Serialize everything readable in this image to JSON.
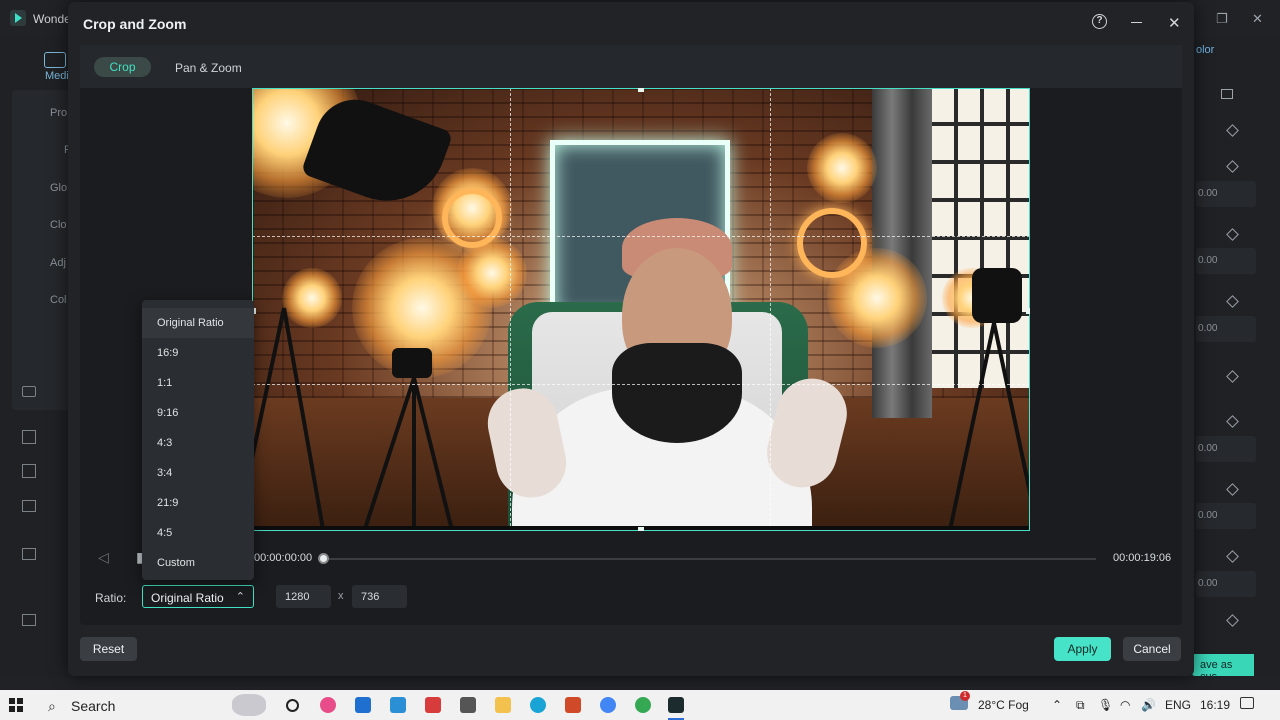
{
  "app": {
    "title": "Wonde",
    "left_items": [
      "Medi",
      "Pro",
      "F",
      "Glo",
      "Clo",
      "Adj",
      "Col"
    ],
    "right_tab": "olor",
    "right_values": [
      "0.00",
      "0.00",
      "0.00",
      "0.00",
      "0.00",
      "0.00",
      "0.00"
    ],
    "save_custom_label": "ave as cus..."
  },
  "dialog": {
    "title": "Crop and Zoom",
    "tabs": [
      {
        "label": "Crop",
        "active": true
      },
      {
        "label": "Pan & Zoom",
        "active": false
      }
    ]
  },
  "playback": {
    "current_time": "00:00:00:00",
    "total_time": "00:00:19:06",
    "progress": 0.0
  },
  "ratio": {
    "label": "Ratio:",
    "selected": "Original Ratio",
    "width": "1280",
    "separator": "x",
    "height": "736",
    "options": [
      "Original Ratio",
      "16:9",
      "1:1",
      "9:16",
      "4:3",
      "3:4",
      "21:9",
      "4:5",
      "Custom"
    ]
  },
  "buttons": {
    "reset": "Reset",
    "apply": "Apply",
    "cancel": "Cancel"
  },
  "taskbar": {
    "search_label": "Search",
    "weather": "28°C  Fog",
    "language": "ENG",
    "clock": "16:19",
    "notification_count": "1"
  },
  "colors": {
    "accent": "#3fe3c4",
    "apply_bg": "#47e3c8",
    "dialog_bg": "#212327"
  }
}
